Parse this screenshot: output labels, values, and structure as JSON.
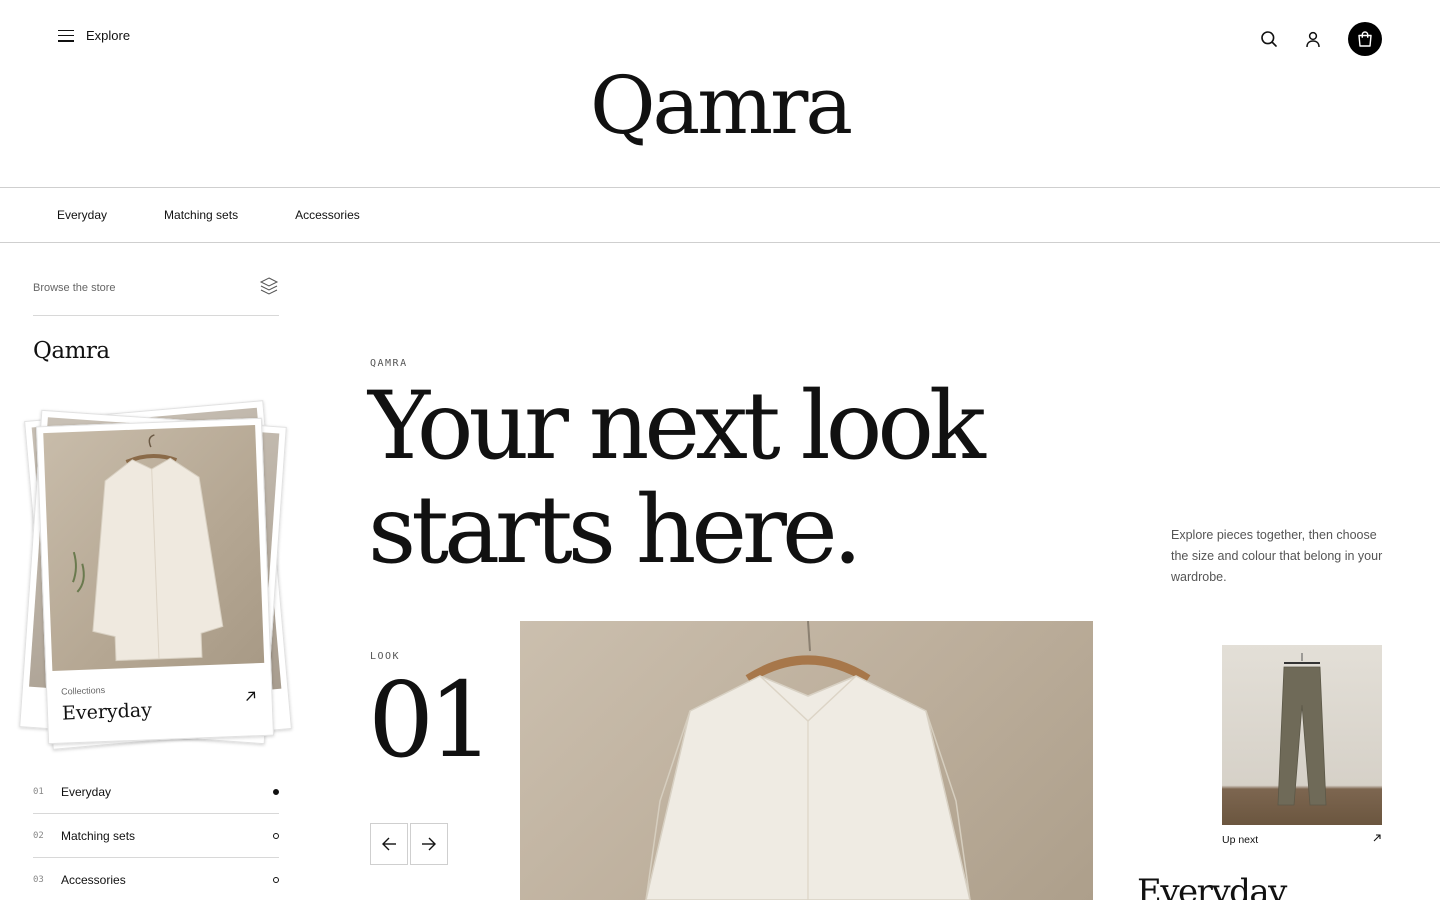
{
  "header": {
    "explore_label": "Explore",
    "logo": "Qamra",
    "icons": [
      "menu-icon",
      "search-icon",
      "user-icon",
      "bag-icon"
    ]
  },
  "category_nav": {
    "items": [
      "Everyday",
      "Matching sets",
      "Accessories"
    ]
  },
  "sidebar": {
    "browse_label": "Browse the store",
    "logo": "Qamra",
    "card": {
      "small_label": "Collections",
      "title": "Everyday"
    },
    "list": [
      {
        "num": "01",
        "label": "Everyday",
        "active": true
      },
      {
        "num": "02",
        "label": "Matching sets",
        "active": false
      },
      {
        "num": "03",
        "label": "Accessories",
        "active": false
      }
    ]
  },
  "hero": {
    "eyebrow": "QAMRA",
    "headline_line1": "Your next look",
    "headline_line2": "starts here.",
    "intro": "Explore pieces together, then choose the size and colour that belong in your wardrobe.",
    "look_label": "LOOK",
    "look_number": "01"
  },
  "upnext": {
    "label": "Up next",
    "title": "Everyday"
  },
  "colors": {
    "accent": "#000000",
    "rule": "#cfcfcf",
    "muted_text": "#555555"
  }
}
